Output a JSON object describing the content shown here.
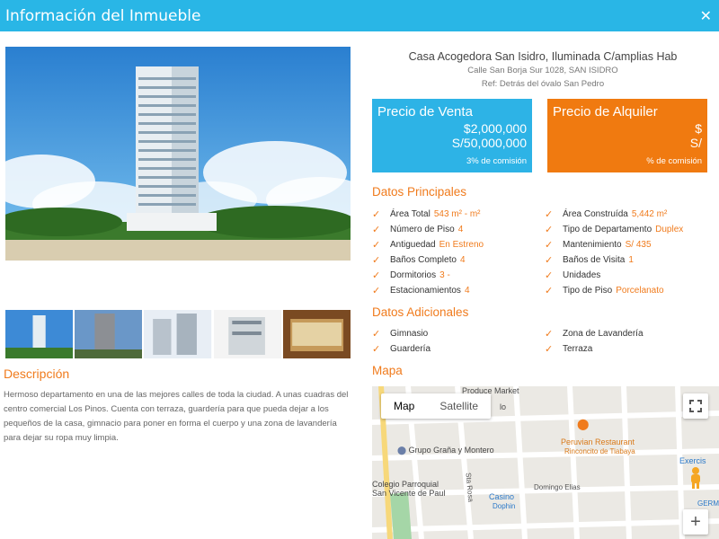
{
  "header": {
    "title": "Información del Inmueble",
    "close": "✕"
  },
  "property": {
    "title": "Casa Acogedora San Isidro, Iluminada C/amplias Hab",
    "address": "Calle San Borja Sur 1028, SAN ISIDRO",
    "reference": "Ref: Detrás del óvalo San Pedro"
  },
  "prices": {
    "sale": {
      "label": "Precio de Venta",
      "usd": "$2,000,000",
      "pen": "S/50,000,000",
      "commission": "3% de comisión"
    },
    "rent": {
      "label": "Precio de Alquiler",
      "usd": "$",
      "pen": "S/",
      "commission": "% de comisión"
    }
  },
  "datos_principales": {
    "title": "Datos Principales",
    "left": [
      {
        "label": "Área Total",
        "value": "543 m² - m²"
      },
      {
        "label": "Número de Piso",
        "value": "4"
      },
      {
        "label": "Antiguedad",
        "value": "En Estreno"
      },
      {
        "label": "Baños Completo",
        "value": "4"
      },
      {
        "label": "Dormitorios",
        "value": "3 -"
      },
      {
        "label": "Estacionamientos",
        "value": "4"
      }
    ],
    "right": [
      {
        "label": "Área Construída",
        "value": "5,442 m²"
      },
      {
        "label": "Tipo de Departamento",
        "value": "Duplex"
      },
      {
        "label": "Mantenimiento",
        "value": "S/ 435"
      },
      {
        "label": "Baños de Visita",
        "value": "1"
      },
      {
        "label": "Unidades",
        "value": ""
      },
      {
        "label": "Tipo de Piso",
        "value": "Porcelanato"
      }
    ]
  },
  "datos_adicionales": {
    "title": "Datos Adicionales",
    "left": [
      "Gimnasio",
      "Guardería"
    ],
    "right": [
      "Zona de Lavandería",
      "Terraza"
    ]
  },
  "description": {
    "title": "Descripción",
    "text": "Hermoso departamento en una de las mejores calles de toda la ciudad. A unas cuadras del centro comercial Los Pinos. Cuenta con terraza, guardería para que pueda dejar a los pequeños de la casa, gimnacio para poner en forma el cuerpo y una zona de lavandería para dejar su ropa muy limpia."
  },
  "map": {
    "title": "Mapa",
    "tabs": [
      "Map",
      "Satellite"
    ],
    "labels": {
      "produce": "Produce Market",
      "grupo": "Grupo Graña y Montero",
      "peruvian": "Peruvian Restaurant",
      "rinconcito": "Rinconcito de Tiabaya",
      "colegio1": "Colegio Parroquial",
      "colegio2": "San Vicente de Paul",
      "casino": "Casino",
      "dophin": "Dophin",
      "domingo": "Domingo Elias",
      "starosa": "Sta Rosa",
      "exercis": "Exercis",
      "germs": "GERMS",
      "tio": "lo"
    },
    "zoom_in": "+"
  },
  "colors": {
    "accent": "#f07b1d",
    "header": "#29b6e6",
    "sale": "#2db3e6",
    "rent": "#f07a10"
  }
}
